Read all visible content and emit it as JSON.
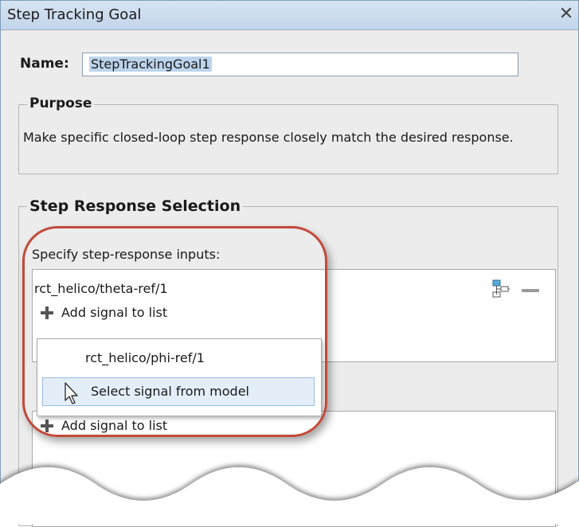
{
  "window": {
    "title": "Step Tracking Goal",
    "close_glyph": "✕"
  },
  "name": {
    "label": "Name:",
    "value": "StepTrackingGoal1"
  },
  "purpose": {
    "title": "Purpose",
    "text": "Make specific closed-loop step response closely match the desired response."
  },
  "step_response": {
    "title": "Step Response Selection",
    "inputs_label": "Specify step-response inputs:",
    "signals": [
      "rct_helico/theta-ref/1"
    ],
    "add_label": "Add signal to list"
  },
  "dropdown": {
    "items": [
      "rct_helico/phi-ref/1",
      "Select signal from model"
    ]
  },
  "second_list": {
    "add_label": "Add signal to list"
  },
  "colors": {
    "highlight": "#c24a3a",
    "title_bar": "#c9d9ec",
    "selection": "#bcd4ec"
  },
  "icons": {
    "close": "close-icon",
    "select_from_model": "select-from-model-icon",
    "remove": "remove-icon",
    "add": "plus-icon",
    "cursor": "mouse-cursor-icon"
  }
}
